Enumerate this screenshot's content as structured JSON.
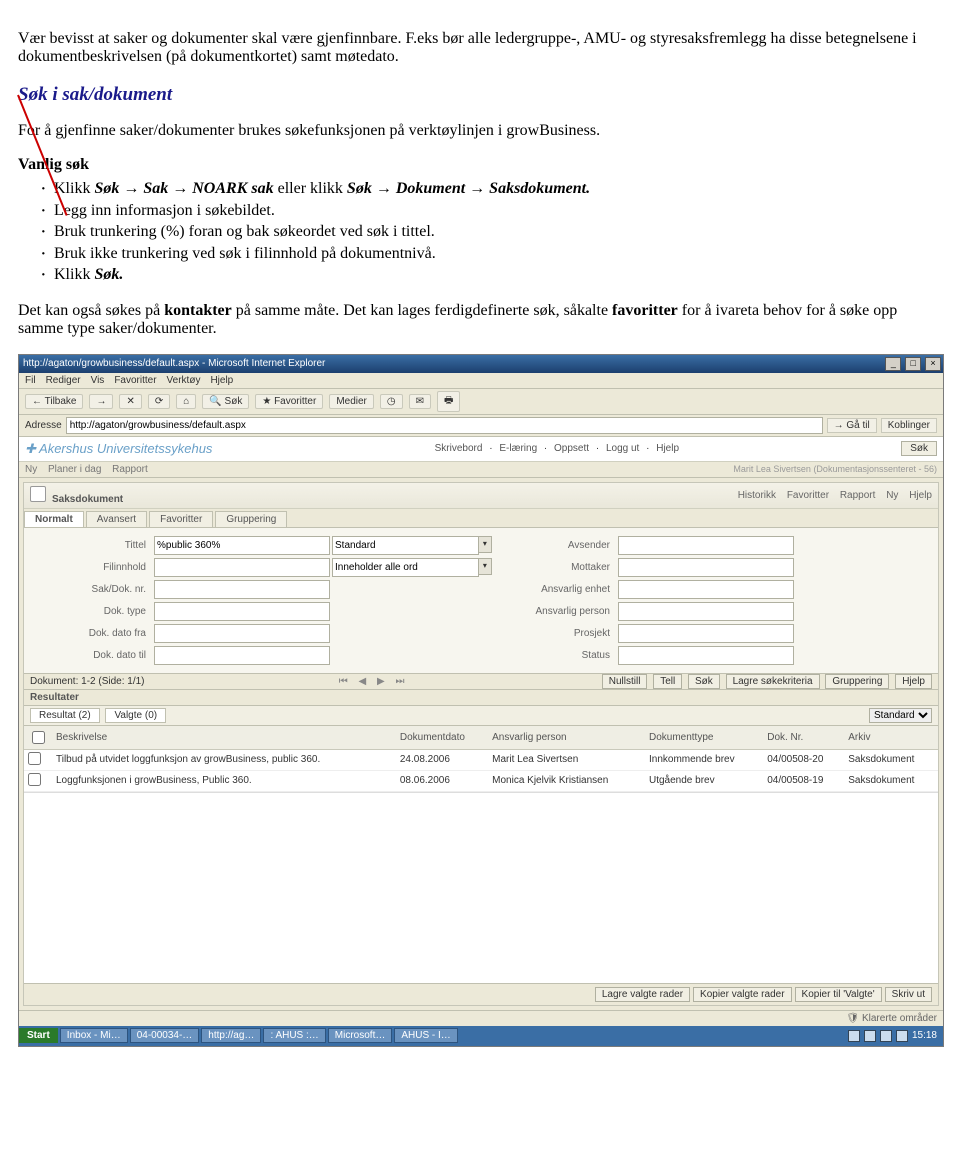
{
  "doc": {
    "intro": "Vær bevisst at saker og dokumenter skal være gjenfinnbare. F.eks bør alle ledergruppe-, AMU- og styresaksfremlegg ha disse betegnelsene i dokumentbeskrivelsen (på dokumentkortet) samt møtedato.",
    "heading": "Søk i sak/dokument",
    "para1": "For å gjenfinne saker/dokumenter brukes søkefunksjonen på verktøylinjen i growBusiness.",
    "vanlig": "Vanlig søk",
    "b1a": "Klikk ",
    "b1b": "Søk → Sak → NOARK sak",
    "b1c": " eller klikk ",
    "b1d": "Søk → Dokument → Saksdokument.",
    "b2": "Legg inn informasjon i søkebildet.",
    "b3": "Bruk trunkering (%) foran og bak søkeordet ved søk i tittel.",
    "b4": "Bruk ikke trunkering ved søk i filinnhold på dokumentnivå.",
    "b5a": "Klikk ",
    "b5b": "Søk.",
    "para2a": "Det kan også søkes på ",
    "para2b": "kontakter",
    "para2c": " på samme måte. Det kan lages ferdigdefinerte søk, såkalte ",
    "para2d": "favoritter",
    "para2e": " for å ivareta behov for å søke opp samme type saker/dokumenter."
  },
  "shot": {
    "title": "http://agaton/growbusiness/default.aspx - Microsoft Internet Explorer",
    "menus": [
      "Fil",
      "Rediger",
      "Vis",
      "Favoritter",
      "Verktøy",
      "Hjelp"
    ],
    "ieToolbar": {
      "back": "Tilbake",
      "fwd": "",
      "sok": "Søk",
      "fav": "Favoritter",
      "med": "Medier"
    },
    "addressLabel": "Adresse",
    "url": "http://agaton/growbusiness/default.aspx",
    "gaTil": "Gå til",
    "koblinger": "Koblinger",
    "brand": "Akershus Universitetssykehus",
    "applinks": [
      "Skrivebord",
      "E-læring",
      "Oppsett",
      "Logg ut",
      "Hjelp"
    ],
    "sokBtn": "Søk",
    "grey": {
      "ny": "Ny",
      "planer": "Planer i dag",
      "rapport": "Rapport",
      "user": "Marit Lea Sivertsen (Dokumentasjonssenteret - 56)"
    },
    "panelTitle": "Saksdokument",
    "panelLinks": [
      "Historikk",
      "Favoritter",
      "Rapport",
      "Ny",
      "Hjelp"
    ],
    "tabs": [
      "Normalt",
      "Avansert",
      "Favoritter",
      "Gruppering"
    ],
    "labels": {
      "tittel": "Tittel",
      "filinnhold": "Filinnhold",
      "sakdok": "Sak/Dok. nr.",
      "doktype": "Dok. type",
      "datofra": "Dok. dato fra",
      "datotil": "Dok. dato til",
      "avsender": "Avsender",
      "mottaker": "Mottaker",
      "ansvEnhet": "Ansvarlig enhet",
      "ansvPerson": "Ansvarlig person",
      "prosjekt": "Prosjekt",
      "status": "Status"
    },
    "values": {
      "tittel": "%public 360%"
    },
    "selects": {
      "standard": "Standard",
      "inneholder": "Inneholder alle ord"
    },
    "docLine": "Dokument: 1-2 (Side: 1/1)",
    "rightBtns": [
      "Nullstill",
      "Tell",
      "Søk",
      "Lagre søkekriteria",
      "Gruppering",
      "Hjelp"
    ],
    "resHeader": "Resultater",
    "resTabs": {
      "a": "Resultat (2)",
      "b": "Valgte (0)"
    },
    "resSelect": "Standard",
    "cols": [
      "",
      "Beskrivelse",
      "Dokumentdato",
      "Ansvarlig person",
      "Dokumenttype",
      "Dok. Nr.",
      "Arkiv"
    ],
    "rows": [
      {
        "besk": "Tilbud på utvidet loggfunksjon av growBusiness, public 360.",
        "dato": "24.08.2006",
        "pers": "Marit Lea Sivertsen",
        "type": "Innkommende brev",
        "nr": "04/00508-20",
        "arkiv": "Saksdokument"
      },
      {
        "besk": "Loggfunksjonen i growBusiness, Public 360.",
        "dato": "08.06.2006",
        "pers": "Monica Kjelvik Kristiansen",
        "type": "Utgående brev",
        "nr": "04/00508-19",
        "arkiv": "Saksdokument"
      }
    ],
    "bottomBtns": [
      "Lagre valgte rader",
      "Kopier valgte rader",
      "Kopier til 'Valgte'",
      "Skriv ut"
    ],
    "status": "Klarerte områder",
    "taskbar": {
      "start": "Start",
      "items": [
        "Inbox - Mi…",
        "04-00034-…",
        "http://ag…",
        ": AHUS :…",
        "Microsoft…",
        "AHUS - I…"
      ],
      "clock": "15:18"
    }
  }
}
